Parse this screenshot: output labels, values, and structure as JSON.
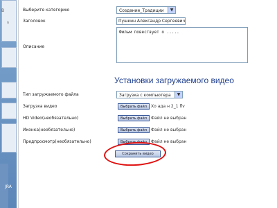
{
  "sidebar": {
    "mark_top": "B",
    "mark_small": "n",
    "bottom_text": "JRA"
  },
  "form": {
    "category_label": "Выберите категорию",
    "category_value": "Создание_Традиции",
    "title_label": "Заголовок",
    "title_value": "Пушкин Александр Сергеевич",
    "description_label": "Описание",
    "description_value": "Фильм повествует о ....."
  },
  "video_section": {
    "title": "Установки загружаемого видео",
    "type_label": "Тип загружаемого файла",
    "type_value": "Загрузка с компьютера",
    "upload_label": "Загрузка видео",
    "upload_button": "Выбрать файл",
    "upload_status": "Хо ада н 2_1 flv",
    "hd_label": "HD Video(необязательно)",
    "hd_button": "Выбрать файл",
    "hd_status": "Файл не выбран",
    "icon_label": "Иконка(необязательно)",
    "icon_button": "Выбрать файл",
    "icon_status": "Файл не выбран",
    "preview_label": "Предпросмотр(необязательно)",
    "preview_button": "Выбрать файл",
    "preview_status": "Файл не выбран",
    "save_button": "Сохранить видео"
  },
  "colors": {
    "highlight_circle": "#e01010",
    "section_title": "#1f3f8f",
    "sidebar": "#6e93c0"
  }
}
